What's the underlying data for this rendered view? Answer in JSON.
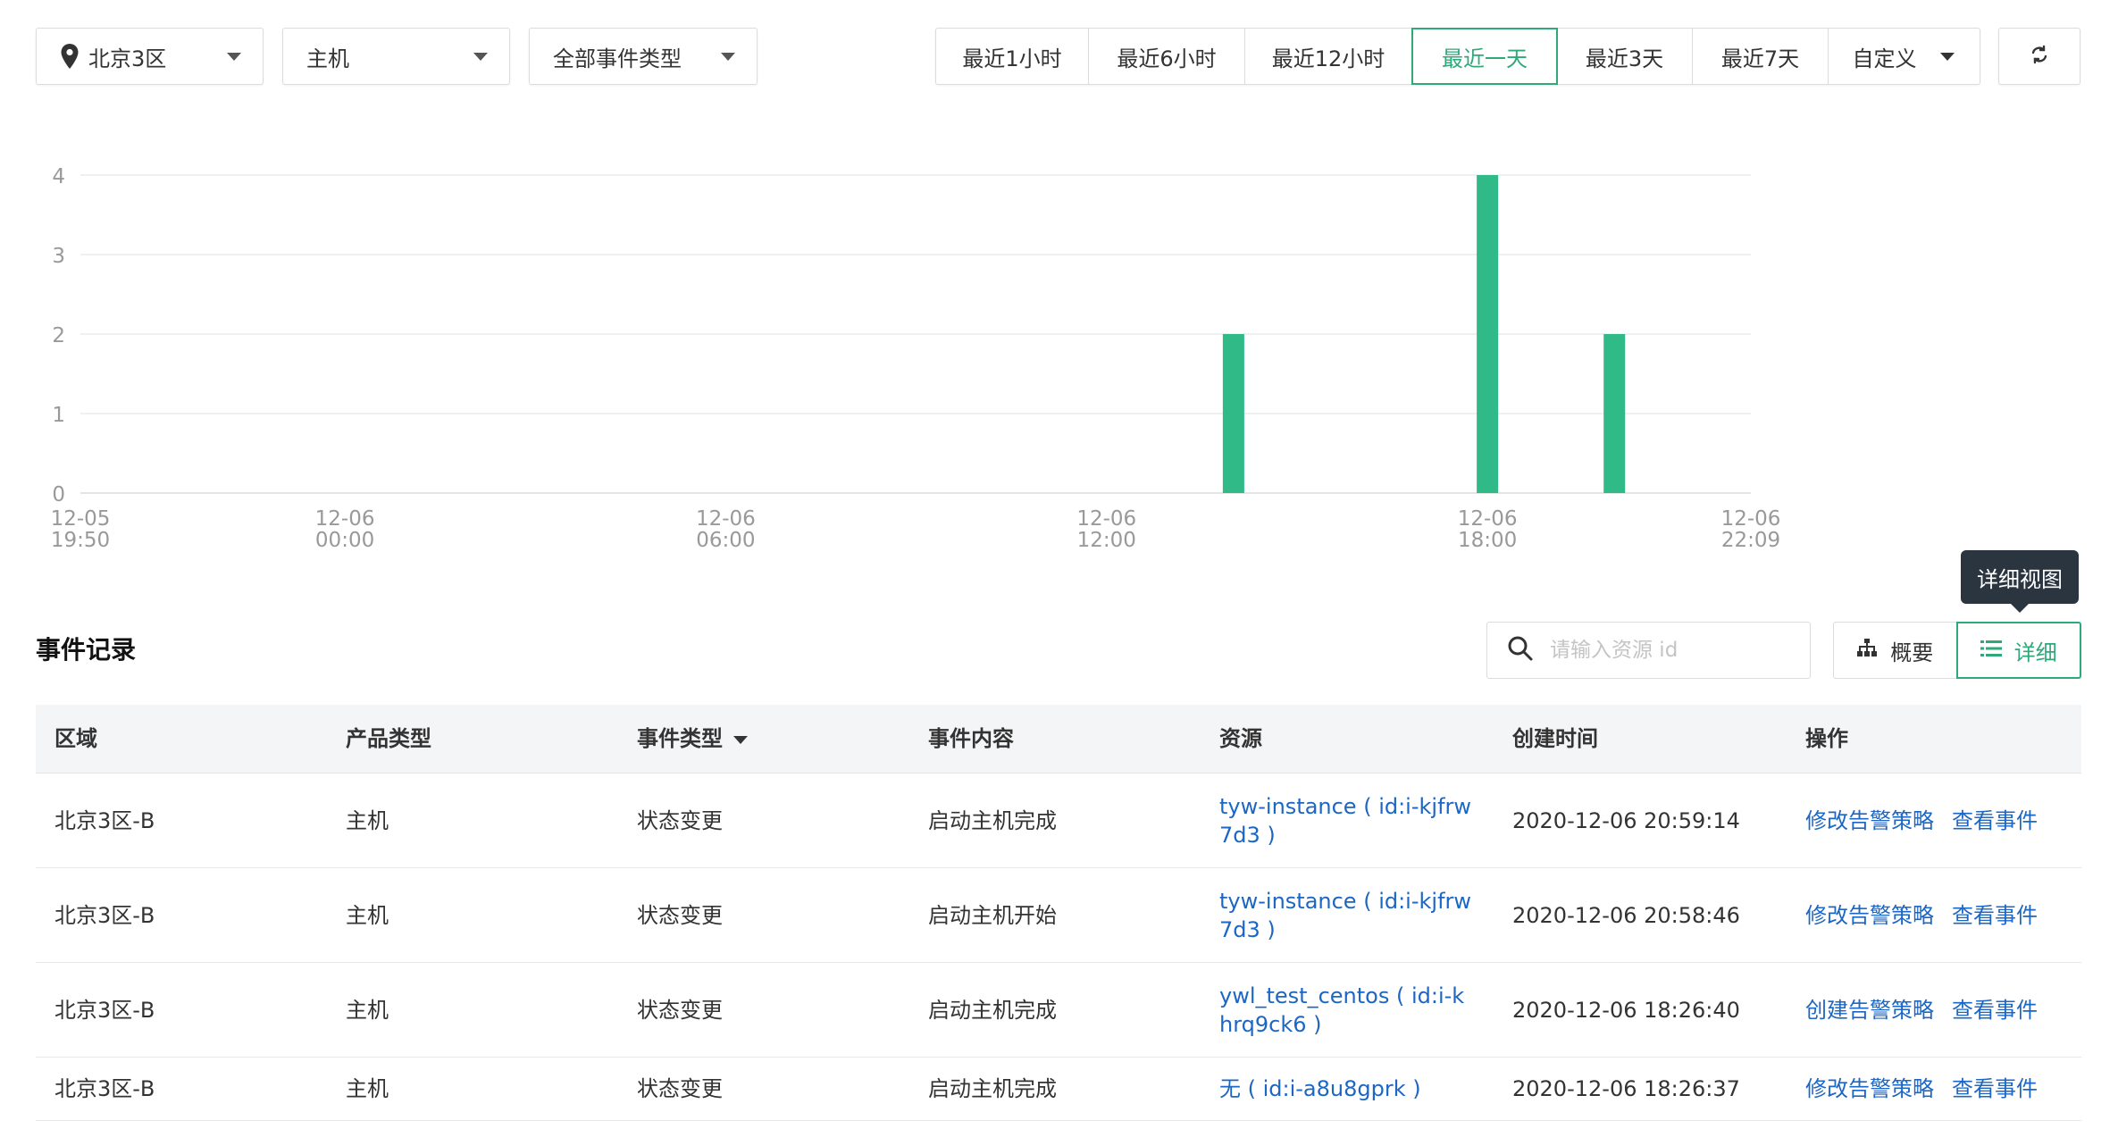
{
  "filters": {
    "region": "北京3区",
    "product": "主机",
    "event_type": "全部事件类型"
  },
  "time_ranges": [
    {
      "label": "最近1小时",
      "active": false
    },
    {
      "label": "最近6小时",
      "active": false
    },
    {
      "label": "最近12小时",
      "active": false
    },
    {
      "label": "最近一天",
      "active": true
    },
    {
      "label": "最近3天",
      "active": false
    },
    {
      "label": "最近7天",
      "active": false
    },
    {
      "label": "自定义",
      "active": false
    }
  ],
  "chart_data": {
    "type": "bar",
    "ylim": [
      0,
      4
    ],
    "yticks": [
      "0",
      "1",
      "2",
      "3",
      "4"
    ],
    "x_start": "2020-12-05 19:50",
    "x_end": "2020-12-06 22:09",
    "x_ticks": [
      {
        "date": "12-05",
        "time": "19:50",
        "at": "2020-12-05 19:50"
      },
      {
        "date": "12-06",
        "time": "00:00",
        "at": "2020-12-06 00:00"
      },
      {
        "date": "12-06",
        "time": "06:00",
        "at": "2020-12-06 06:00"
      },
      {
        "date": "12-06",
        "time": "12:00",
        "at": "2020-12-06 12:00"
      },
      {
        "date": "12-06",
        "time": "18:00",
        "at": "2020-12-06 18:00"
      },
      {
        "date": "12-06",
        "time": "22:09",
        "at": "2020-12-06 22:09"
      }
    ],
    "bars": [
      {
        "x": "2020-12-06 14:00",
        "value": 2
      },
      {
        "x": "2020-12-06 18:00",
        "value": 4
      },
      {
        "x": "2020-12-06 20:00",
        "value": 2
      }
    ],
    "color": "#2fba87",
    "grid": true
  },
  "section": {
    "title": "事件记录",
    "search_placeholder": "请输入资源 id",
    "view_summary": "概要",
    "view_detail": "详细",
    "tooltip": "详细视图"
  },
  "table": {
    "headers": [
      "区域",
      "产品类型",
      "事件类型",
      "事件内容",
      "资源",
      "创建时间",
      "操作"
    ],
    "rows": [
      {
        "region": "北京3区-B",
        "product": "主机",
        "type": "状态变更",
        "content": "启动主机完成",
        "resource": "tyw-instance ( id:i-kjfrw7d3 )",
        "time": "2020-12-06 20:59:14",
        "op1": "修改告警策略",
        "op2": "查看事件"
      },
      {
        "region": "北京3区-B",
        "product": "主机",
        "type": "状态变更",
        "content": "启动主机开始",
        "resource": "tyw-instance ( id:i-kjfrw7d3 )",
        "time": "2020-12-06 20:58:46",
        "op1": "修改告警策略",
        "op2": "查看事件"
      },
      {
        "region": "北京3区-B",
        "product": "主机",
        "type": "状态变更",
        "content": "启动主机完成",
        "resource": "ywl_test_centos ( id:i-khrq9ck6 )",
        "time": "2020-12-06 18:26:40",
        "op1": "创建告警策略",
        "op2": "查看事件"
      },
      {
        "region": "北京3区-B",
        "product": "主机",
        "type": "状态变更",
        "content": "启动主机完成",
        "resource": "无 ( id:i-a8u8gprk )",
        "time": "2020-12-06 18:26:37",
        "op1": "修改告警策略",
        "op2": "查看事件"
      }
    ]
  }
}
